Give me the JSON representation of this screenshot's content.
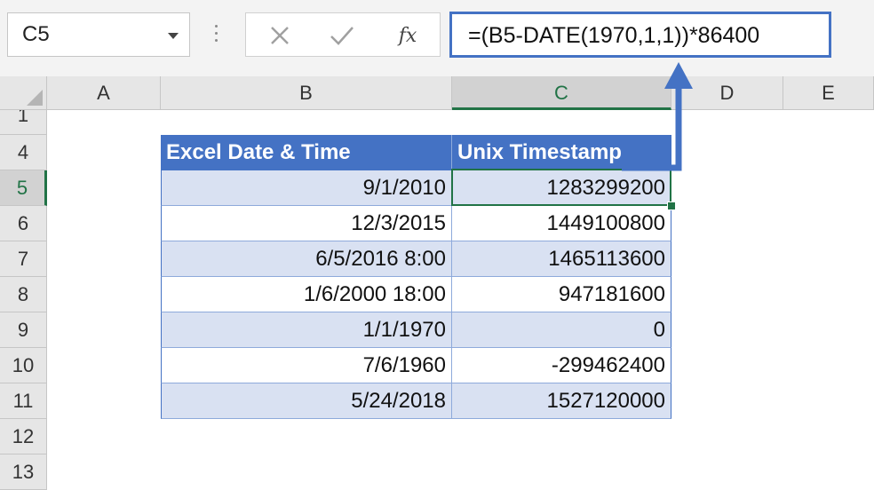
{
  "name_box": {
    "value": "C5"
  },
  "formula_bar": {
    "cancel_icon": "cross-icon",
    "enter_icon": "check-icon",
    "function_label": "fx",
    "formula": "=(B5-DATE(1970,1,1))*86400"
  },
  "columns": [
    "A",
    "B",
    "C",
    "D",
    "E"
  ],
  "selected_column": "C",
  "rows": [
    "1",
    "4",
    "5",
    "6",
    "7",
    "8",
    "9",
    "10",
    "11",
    "12",
    "13"
  ],
  "selected_row": "5",
  "table": {
    "headers": [
      "Excel Date & Time",
      "Unix Timestamp"
    ],
    "rows": [
      [
        "9/1/2010",
        "1283299200"
      ],
      [
        "12/3/2015",
        "1449100800"
      ],
      [
        "6/5/2016 8:00",
        "1465113600"
      ],
      [
        "1/6/2000 18:00",
        "947181600"
      ],
      [
        "1/1/1970",
        "0"
      ],
      [
        "7/6/1960",
        "-299462400"
      ],
      [
        "5/24/2018",
        "1527120000"
      ]
    ]
  },
  "colors": {
    "header_fill": "#4472c4",
    "band_fill": "#d9e1f2",
    "selection": "#217346",
    "arrow": "#4472c4"
  }
}
